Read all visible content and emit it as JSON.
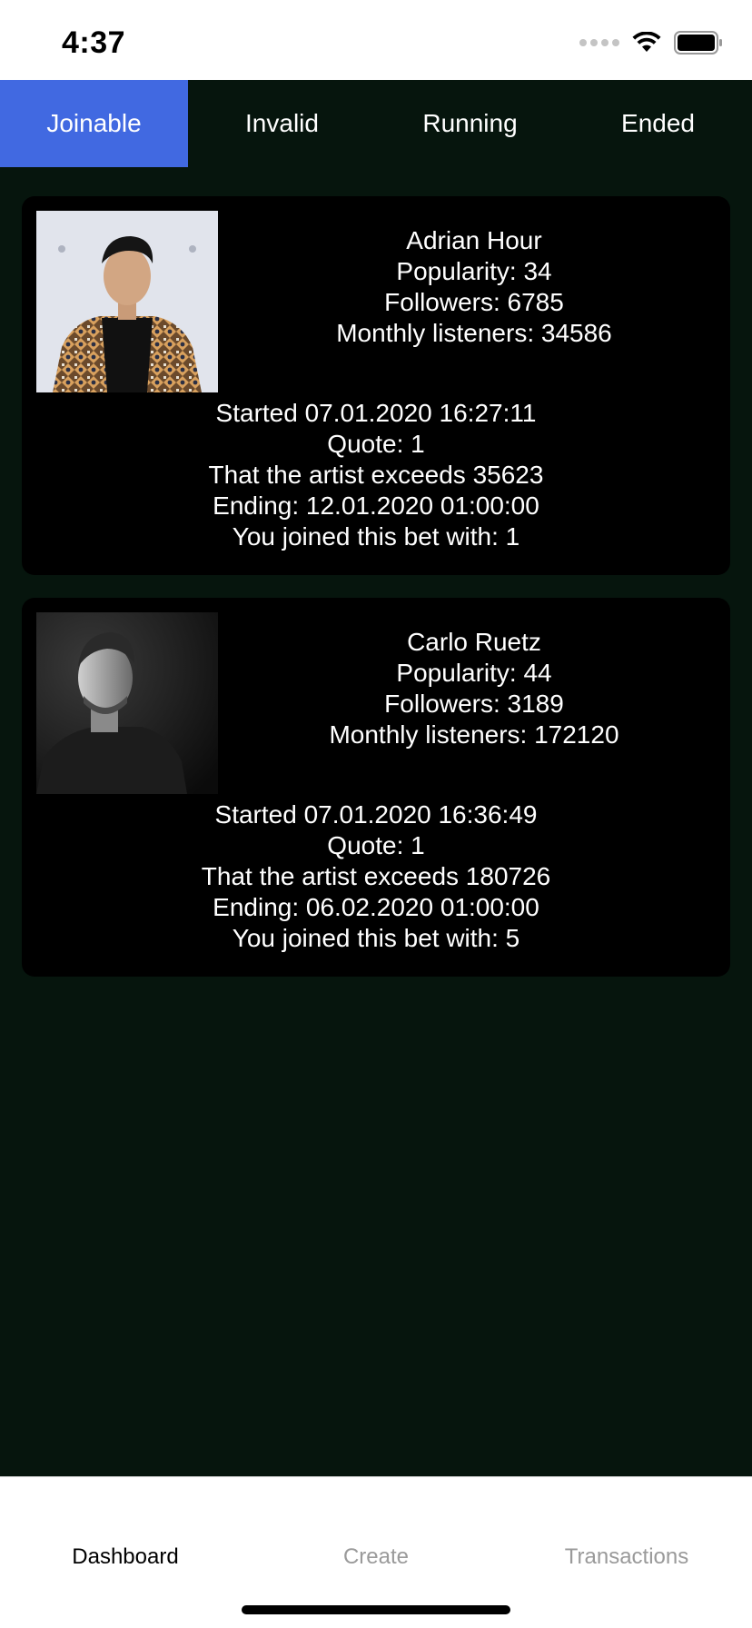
{
  "status_bar": {
    "time": "4:37",
    "icons": [
      "signal-icon",
      "wifi-icon",
      "battery-icon"
    ]
  },
  "tabs": [
    {
      "label": "Joinable",
      "active": true
    },
    {
      "label": "Invalid",
      "active": false
    },
    {
      "label": "Running",
      "active": false
    },
    {
      "label": "Ended",
      "active": false
    }
  ],
  "bets": [
    {
      "artist_name": "Adrian Hour",
      "popularity": "Popularity: 34",
      "followers": "Followers: 6785",
      "monthly_listeners": "Monthly listeners: 34586",
      "started": "Started 07.01.2020 16:27:11",
      "quote": "Quote: 1",
      "threshold": "That the artist exceeds 35623",
      "ending": "Ending: 12.01.2020 01:00:00",
      "joined": "You joined this bet with: 1",
      "photo_style": "color"
    },
    {
      "artist_name": "Carlo Ruetz",
      "popularity": "Popularity: 44",
      "followers": "Followers: 3189",
      "monthly_listeners": "Monthly listeners: 172120",
      "started": "Started 07.01.2020 16:36:49",
      "quote": "Quote: 1",
      "threshold": "That the artist exceeds 180726",
      "ending": "Ending: 06.02.2020 01:00:00",
      "joined": "You joined this bet with: 5",
      "photo_style": "black-and-white"
    }
  ],
  "bottom_nav": [
    {
      "label": "Dashboard",
      "active": true
    },
    {
      "label": "Create",
      "active": false
    },
    {
      "label": "Transactions",
      "active": false
    }
  ],
  "colors": {
    "background": "#06150d",
    "active_tab": "#4169e1",
    "card": "#000000",
    "text": "#ffffff",
    "nav_inactive": "#9a9a9a"
  }
}
